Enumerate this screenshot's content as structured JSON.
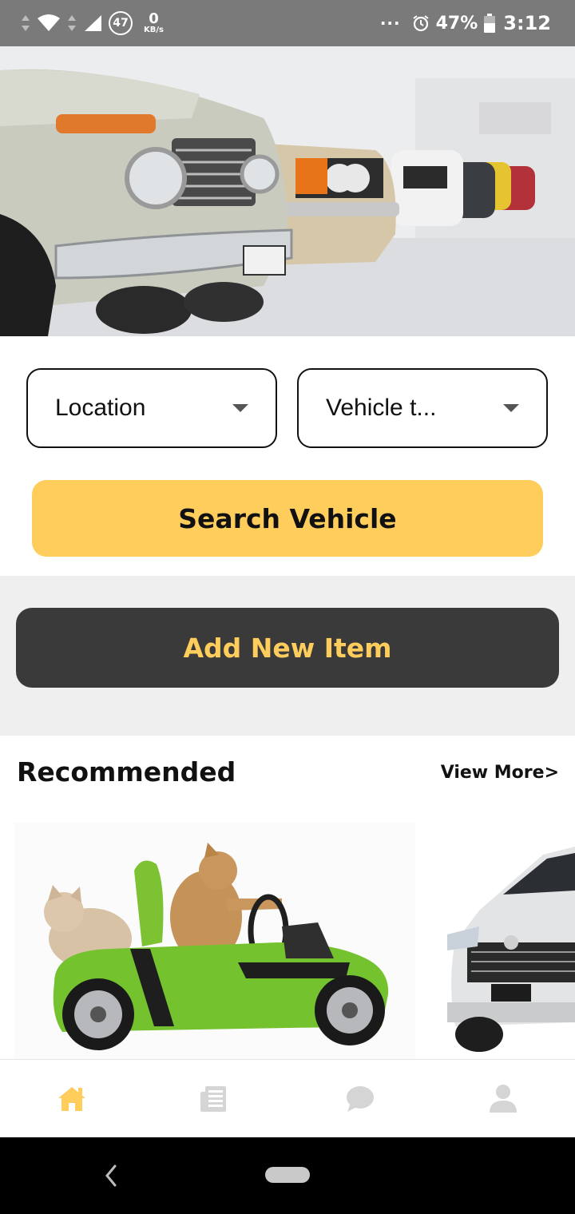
{
  "status_bar": {
    "notification_count": "47",
    "net_speed_value": "0",
    "net_speed_unit": "KB/s",
    "more_dots": "···",
    "battery_percent": "47%",
    "time": "3:12"
  },
  "hero": {
    "image_desc": "row-of-classic-cars"
  },
  "filters": {
    "location_label": "Location",
    "vehicle_type_label": "Vehicle t..."
  },
  "actions": {
    "search_label": "Search Vehicle",
    "add_label": "Add New Item"
  },
  "recommended": {
    "title": "Recommended",
    "view_more_label": "View More>"
  },
  "bottom_nav": {
    "items": [
      {
        "icon": "home-icon",
        "active": true
      },
      {
        "icon": "news-icon",
        "active": false
      },
      {
        "icon": "chat-icon",
        "active": false
      },
      {
        "icon": "profile-icon",
        "active": false
      }
    ]
  },
  "colors": {
    "accent_yellow": "#fecd5c",
    "dark_button": "#3b3a3a",
    "inactive_icon": "#d5d5d5",
    "status_bar": "#7a7a7a"
  }
}
